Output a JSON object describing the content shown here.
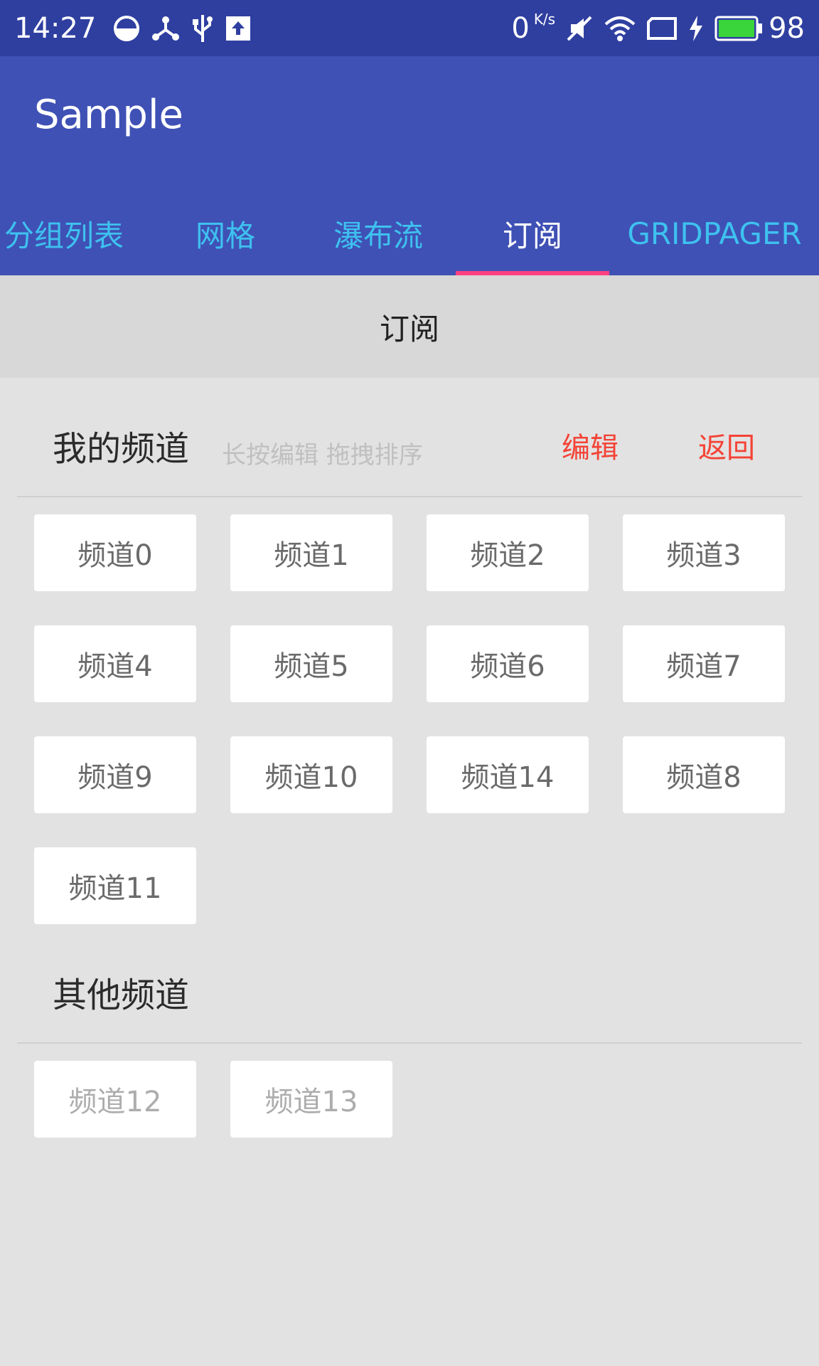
{
  "status_bar": {
    "time": "14:27",
    "net_speed": "0",
    "net_unit": "K/s",
    "battery_percent": "98",
    "icons": [
      "data-saver-icon",
      "share-icon",
      "usb-icon",
      "upload-icon",
      "mute-icon",
      "wifi-icon",
      "screen-icon",
      "charging-icon",
      "battery-icon"
    ]
  },
  "app_bar": {
    "title": "Sample",
    "tabs": [
      {
        "label": "分组列表",
        "active": false
      },
      {
        "label": "网格",
        "active": false
      },
      {
        "label": "瀑布流",
        "active": false
      },
      {
        "label": "订阅",
        "active": true
      },
      {
        "label": "GRIDPAGER",
        "active": false
      }
    ]
  },
  "page_header": {
    "title": "订阅"
  },
  "my_channels": {
    "title": "我的频道",
    "hint": "长按编辑 拖拽排序",
    "edit_label": "编辑",
    "back_label": "返回",
    "items": [
      "频道0",
      "频道1",
      "频道2",
      "频道3",
      "频道4",
      "频道5",
      "频道6",
      "频道7",
      "频道9",
      "频道10",
      "频道14",
      "频道8",
      "频道11"
    ]
  },
  "other_channels": {
    "title": "其他频道",
    "items": [
      "频道12",
      "频道13"
    ]
  },
  "colors": {
    "status_bar": "#2f3fa0",
    "primary": "#3f51b5",
    "accent": "#ff4081",
    "tab_inactive": "#3ec1ef",
    "action_red": "#f44336"
  }
}
